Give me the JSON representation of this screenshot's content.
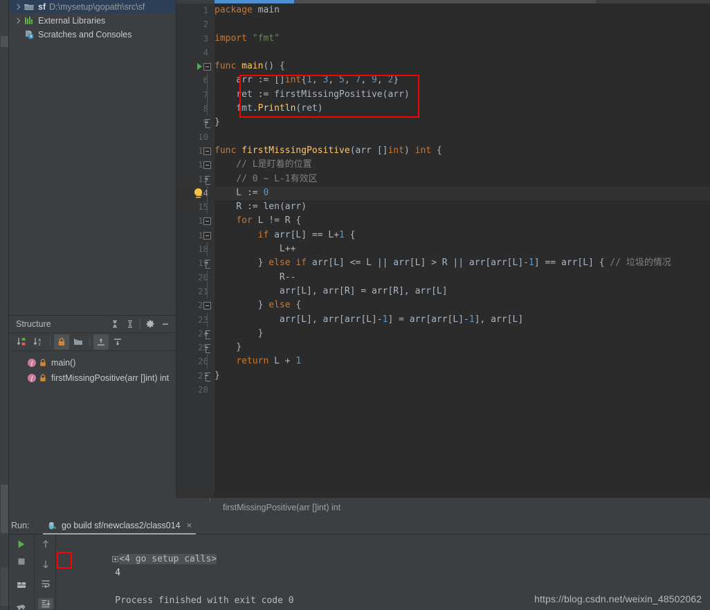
{
  "project": {
    "items": [
      {
        "icon": "folder-icon",
        "name": "sf",
        "path": "D:\\mysetup\\gopath\\src\\sf",
        "selected": true,
        "expandable": true
      },
      {
        "icon": "libraries-icon",
        "name": "External Libraries",
        "path": "",
        "selected": false,
        "expandable": true
      },
      {
        "icon": "scratches-icon",
        "name": "Scratches and Consoles",
        "path": "",
        "selected": false,
        "expandable": false
      }
    ]
  },
  "structure": {
    "title": "Structure",
    "header_buttons": [
      {
        "name": "expand-all-icon",
        "label": "Expand All"
      },
      {
        "name": "collapse-all-icon",
        "label": "Collapse All"
      },
      {
        "name": "gear-icon",
        "label": "Settings"
      },
      {
        "name": "minimize-icon",
        "label": "Hide"
      }
    ],
    "toolbar_buttons": [
      {
        "name": "sort-by-visibility-icon",
        "label": "Sort by Visibility",
        "active": false
      },
      {
        "name": "sort-alphabetically-icon",
        "label": "Sort Alphabetically",
        "active": false
      },
      {
        "name": "show-non-public-icon",
        "label": "Show Non-Public",
        "active": true
      },
      {
        "name": "group-by-file-icon",
        "label": "Group",
        "active": false
      },
      {
        "name": "show-inherited-icon",
        "label": "Show Inherited",
        "active": true
      },
      {
        "name": "show-anonymous-icon",
        "label": "Show Anonymous",
        "active": false
      }
    ],
    "items": [
      {
        "label": "main()",
        "icon": "function-icon",
        "modifier": "lock-icon"
      },
      {
        "label": "firstMissingPositive(arr []int) int",
        "icon": "function-icon",
        "modifier": "lock-icon"
      }
    ]
  },
  "editor": {
    "breadcrumb": "firstMissingPositive(arr []int) int",
    "current_line": 14,
    "run_marker_line": 5,
    "bulb_line": 14,
    "lines": [
      {
        "n": 1,
        "tokens": [
          {
            "t": "package ",
            "c": "kw"
          },
          {
            "t": "main",
            "c": "pkg"
          }
        ]
      },
      {
        "n": 2,
        "tokens": []
      },
      {
        "n": 3,
        "tokens": [
          {
            "t": "import ",
            "c": "kw"
          },
          {
            "t": "\"fmt\"",
            "c": "str"
          }
        ]
      },
      {
        "n": 4,
        "tokens": []
      },
      {
        "n": 5,
        "tokens": [
          {
            "t": "func ",
            "c": "kw"
          },
          {
            "t": "main",
            "c": "fn"
          },
          {
            "t": "() {",
            "c": "pl"
          }
        ]
      },
      {
        "n": 6,
        "tokens": [
          {
            "t": "    arr := []",
            "c": "pl"
          },
          {
            "t": "int",
            "c": "typ"
          },
          {
            "t": "{",
            "c": "pl"
          },
          {
            "t": "1",
            "c": "num"
          },
          {
            "t": ", ",
            "c": "pl"
          },
          {
            "t": "3",
            "c": "num"
          },
          {
            "t": ", ",
            "c": "pl"
          },
          {
            "t": "5",
            "c": "num"
          },
          {
            "t": ", ",
            "c": "pl"
          },
          {
            "t": "7",
            "c": "num"
          },
          {
            "t": ", ",
            "c": "pl"
          },
          {
            "t": "9",
            "c": "num"
          },
          {
            "t": ", ",
            "c": "pl"
          },
          {
            "t": "2",
            "c": "num"
          },
          {
            "t": "}",
            "c": "pl"
          }
        ]
      },
      {
        "n": 7,
        "tokens": [
          {
            "t": "    ret := ",
            "c": "pl"
          },
          {
            "t": "firstMissingPositive",
            "c": "pl"
          },
          {
            "t": "(arr)",
            "c": "pl"
          }
        ]
      },
      {
        "n": 8,
        "tokens": [
          {
            "t": "    fmt.",
            "c": "pl"
          },
          {
            "t": "Println",
            "c": "fn"
          },
          {
            "t": "(ret)",
            "c": "pl"
          }
        ]
      },
      {
        "n": 9,
        "tokens": [
          {
            "t": "}",
            "c": "pl"
          }
        ]
      },
      {
        "n": 10,
        "tokens": []
      },
      {
        "n": 11,
        "tokens": [
          {
            "t": "func ",
            "c": "kw"
          },
          {
            "t": "firstMissingPositive",
            "c": "fn"
          },
          {
            "t": "(arr []",
            "c": "pl"
          },
          {
            "t": "int",
            "c": "typ"
          },
          {
            "t": ") ",
            "c": "pl"
          },
          {
            "t": "int",
            "c": "typ"
          },
          {
            "t": " {",
            "c": "pl"
          }
        ]
      },
      {
        "n": 12,
        "tokens": [
          {
            "t": "    // L是盯着的位置",
            "c": "cmt"
          }
        ]
      },
      {
        "n": 13,
        "tokens": [
          {
            "t": "    // 0 ~ L-1有效区",
            "c": "cmt"
          }
        ]
      },
      {
        "n": 14,
        "tokens": [
          {
            "t": "    L := ",
            "c": "pl"
          },
          {
            "t": "0",
            "c": "num"
          }
        ]
      },
      {
        "n": 15,
        "tokens": [
          {
            "t": "    R := ",
            "c": "pl"
          },
          {
            "t": "len",
            "c": "pl"
          },
          {
            "t": "(arr)",
            "c": "pl"
          }
        ]
      },
      {
        "n": 16,
        "tokens": [
          {
            "t": "    ",
            "c": "pl"
          },
          {
            "t": "for ",
            "c": "kw"
          },
          {
            "t": "L != R {",
            "c": "pl"
          }
        ]
      },
      {
        "n": 17,
        "tokens": [
          {
            "t": "        ",
            "c": "pl"
          },
          {
            "t": "if ",
            "c": "kw"
          },
          {
            "t": "arr[L] == L+",
            "c": "pl"
          },
          {
            "t": "1",
            "c": "num"
          },
          {
            "t": " {",
            "c": "pl"
          }
        ]
      },
      {
        "n": 18,
        "tokens": [
          {
            "t": "            L++",
            "c": "pl"
          }
        ]
      },
      {
        "n": 19,
        "tokens": [
          {
            "t": "        } ",
            "c": "pl"
          },
          {
            "t": "else if ",
            "c": "kw"
          },
          {
            "t": "arr[L] <= L || arr[L] > R || arr[arr[L]-",
            "c": "pl"
          },
          {
            "t": "1",
            "c": "num"
          },
          {
            "t": "] == arr[L] { ",
            "c": "pl"
          },
          {
            "t": "// 垃圾的情况",
            "c": "cmt"
          }
        ]
      },
      {
        "n": 20,
        "tokens": [
          {
            "t": "            R--",
            "c": "pl"
          }
        ]
      },
      {
        "n": 21,
        "tokens": [
          {
            "t": "            arr[L], arr[R] = arr[R], arr[L]",
            "c": "pl"
          }
        ]
      },
      {
        "n": 22,
        "tokens": [
          {
            "t": "        } ",
            "c": "pl"
          },
          {
            "t": "else",
            "c": "kw"
          },
          {
            "t": " {",
            "c": "pl"
          }
        ]
      },
      {
        "n": 23,
        "tokens": [
          {
            "t": "            arr[L], arr[arr[L]-",
            "c": "pl"
          },
          {
            "t": "1",
            "c": "num"
          },
          {
            "t": "] = arr[arr[L]-",
            "c": "pl"
          },
          {
            "t": "1",
            "c": "num"
          },
          {
            "t": "], arr[L]",
            "c": "pl"
          }
        ]
      },
      {
        "n": 24,
        "tokens": [
          {
            "t": "        }",
            "c": "pl"
          }
        ]
      },
      {
        "n": 25,
        "tokens": [
          {
            "t": "    }",
            "c": "pl"
          }
        ]
      },
      {
        "n": 26,
        "tokens": [
          {
            "t": "    ",
            "c": "pl"
          },
          {
            "t": "return ",
            "c": "kw"
          },
          {
            "t": "L + ",
            "c": "pl"
          },
          {
            "t": "1",
            "c": "num"
          }
        ]
      },
      {
        "n": 27,
        "tokens": [
          {
            "t": "}",
            "c": "pl"
          }
        ]
      },
      {
        "n": 28,
        "tokens": []
      }
    ],
    "highlight_box": {
      "label": "highlighted-code-region",
      "color": "#ff0000"
    }
  },
  "run_panel": {
    "label": "Run:",
    "tab": {
      "title": "go build sf/newclass2/class014",
      "icon": "go-gopher-icon",
      "close": "×"
    },
    "left_buttons": [
      {
        "name": "rerun-button",
        "icon": "play-icon"
      },
      {
        "name": "stop-button",
        "icon": "stop-icon"
      },
      {
        "name": "layout-button",
        "icon": "layout-icon"
      },
      {
        "name": "pin-button",
        "icon": "pin-icon"
      }
    ],
    "right_buttons": [
      {
        "name": "prev-occurrence-button",
        "icon": "arrow-up-icon"
      },
      {
        "name": "next-occurrence-button",
        "icon": "arrow-down-icon"
      },
      {
        "name": "soft-wrap-button",
        "icon": "soft-wrap-icon",
        "active": false
      },
      {
        "name": "scroll-to-end-button",
        "icon": "scroll-end-icon",
        "active": true
      }
    ],
    "console": {
      "setup_line": "<4 go setup calls>",
      "output_value": "4",
      "exit_line": "Process finished with exit code 0"
    }
  },
  "watermark": "https://blog.csdn.net/weixin_48502062"
}
